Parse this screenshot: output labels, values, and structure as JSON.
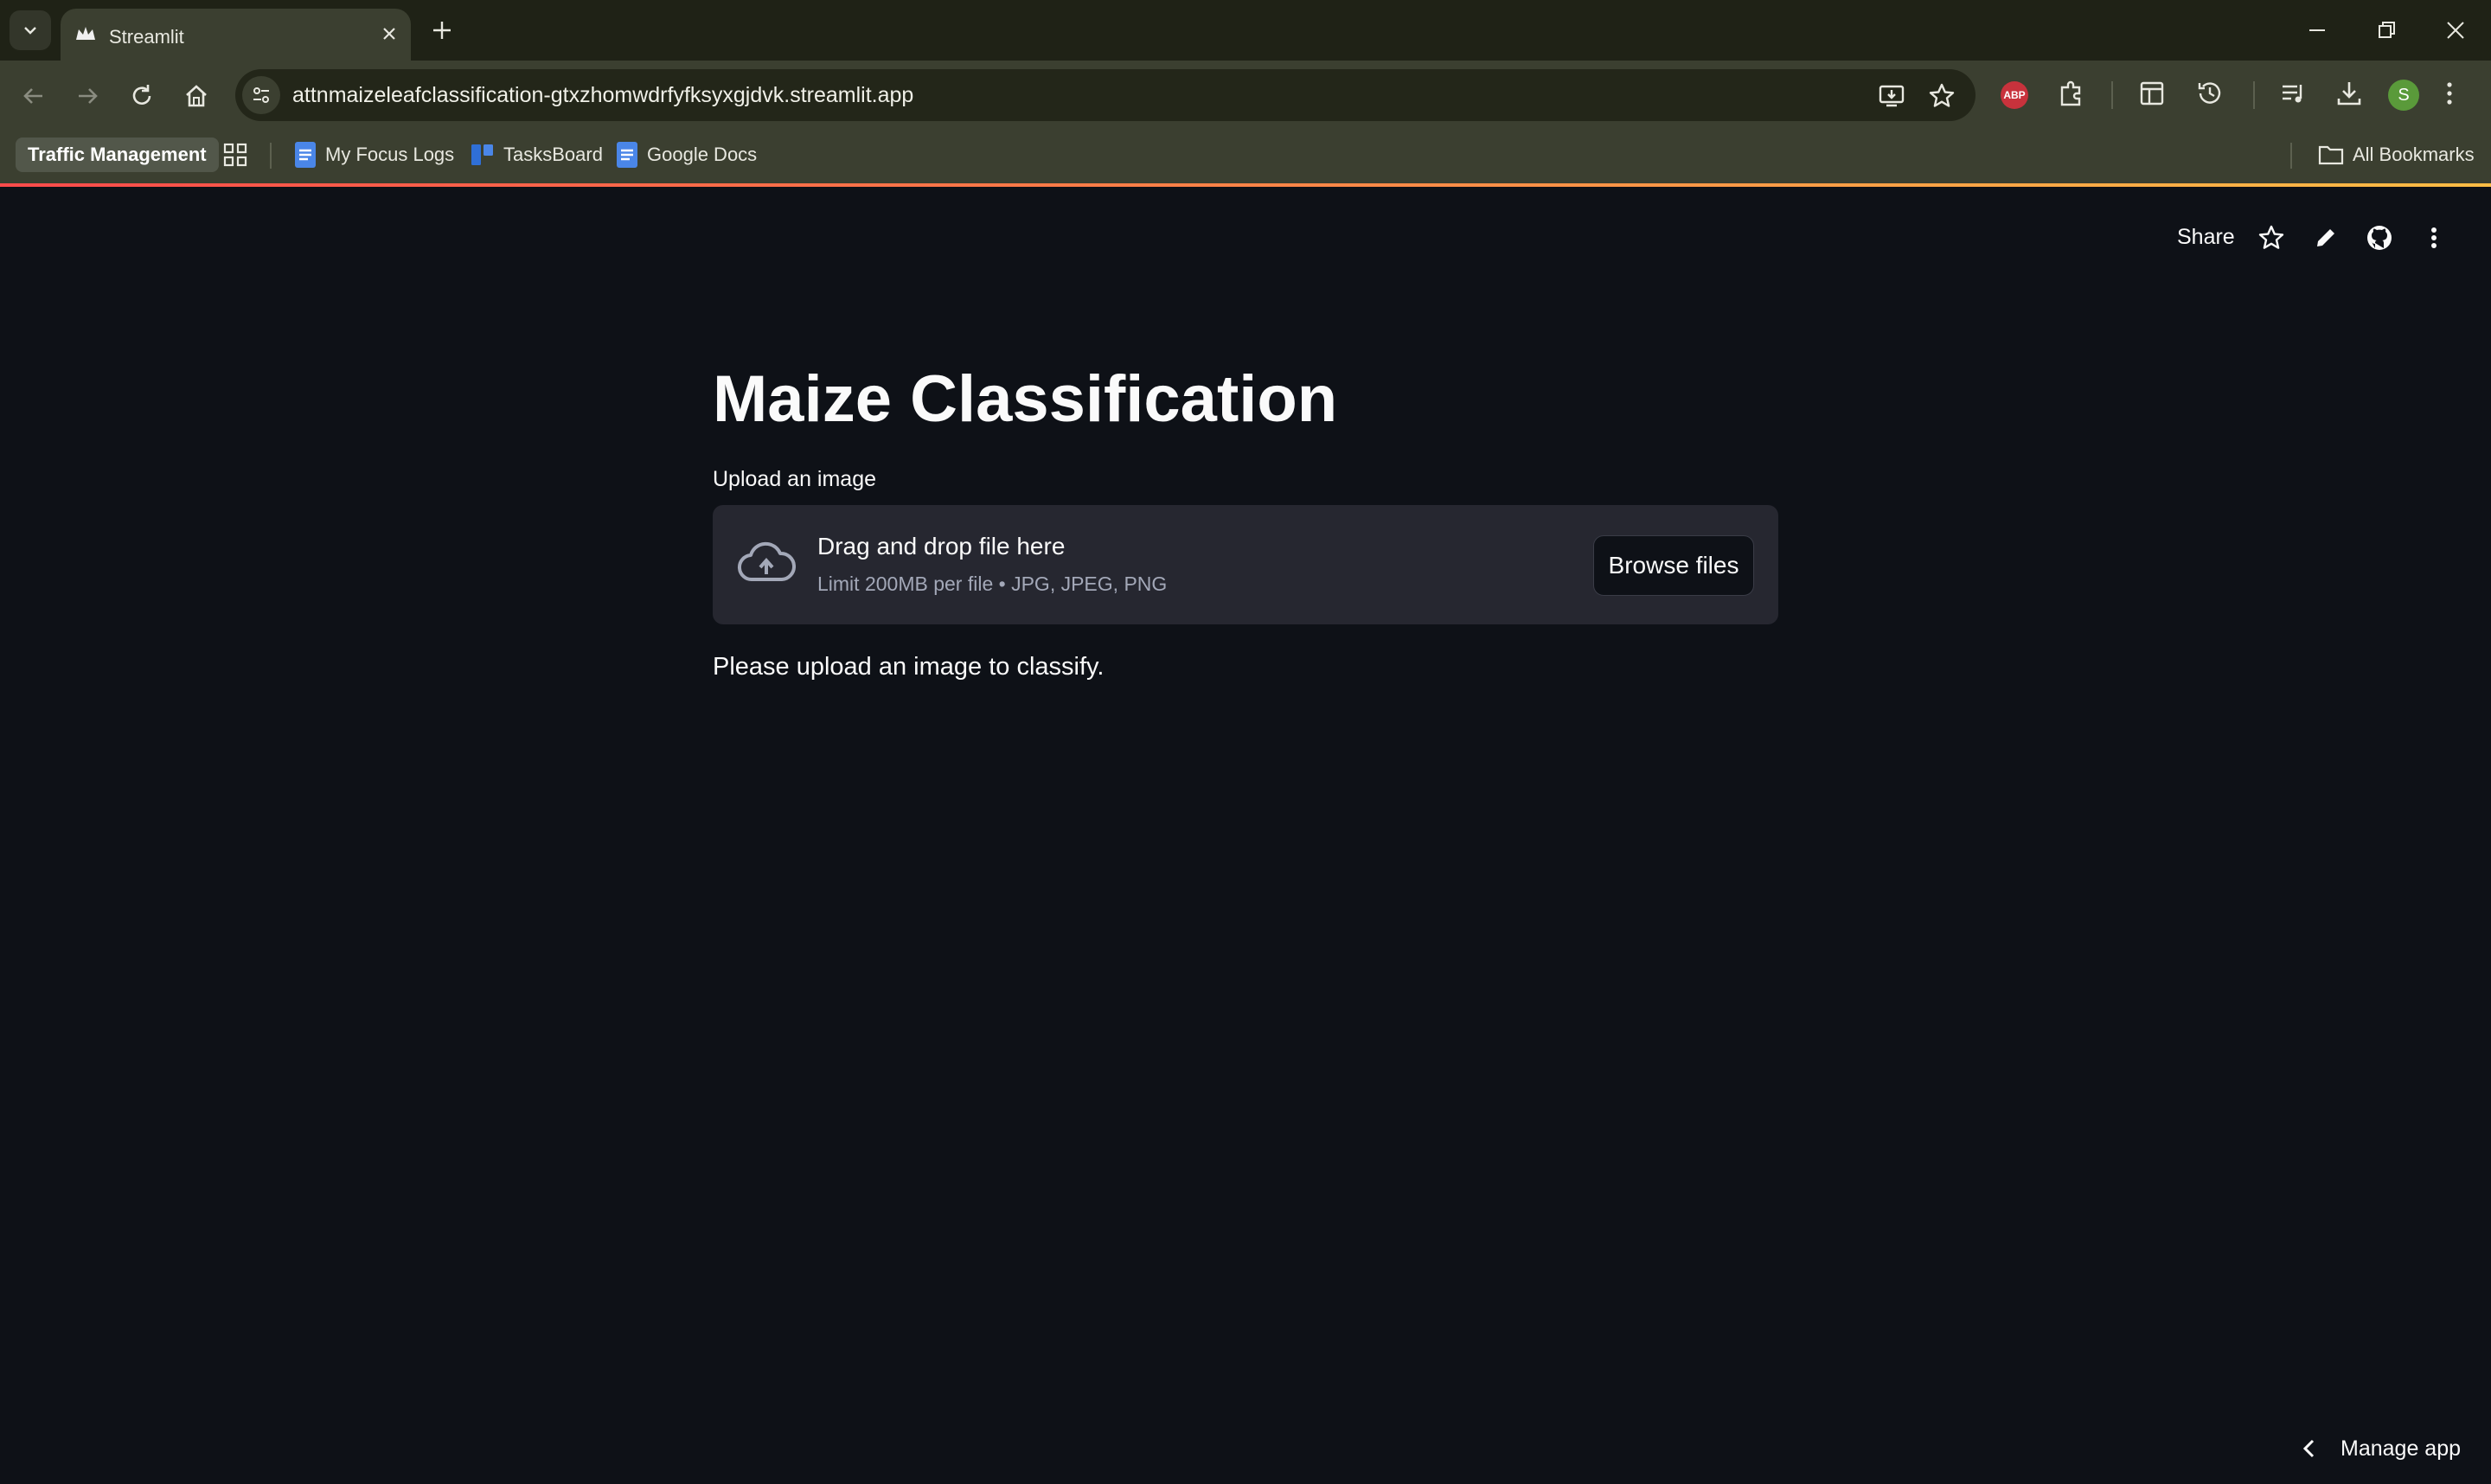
{
  "browser": {
    "tab": {
      "title": "Streamlit"
    },
    "address_bar": {
      "url": "attnmaizeleafclassification-gtxzhomwdrfyfksyxgjdvk.streamlit.app"
    },
    "profile_initial": "S",
    "adblock_label": "ABP",
    "bookmarks": {
      "group": "Traffic Management",
      "items": [
        {
          "label": "My Focus Logs",
          "icon": "google-docs-icon"
        },
        {
          "label": "TasksBoard",
          "icon": "tasksboard-icon"
        },
        {
          "label": "Google Docs",
          "icon": "google-docs-icon"
        }
      ],
      "all_bookmarks": "All Bookmarks"
    }
  },
  "app_header": {
    "share_label": "Share"
  },
  "main": {
    "title": "Maize Classification",
    "uploader": {
      "label": "Upload an image",
      "drop_text": "Drag and drop file here",
      "limit_text": "Limit 200MB per file • JPG, JPEG, PNG",
      "browse_label": "Browse files"
    },
    "status_message": "Please upload an image to classify."
  },
  "footer": {
    "manage_app_label": "Manage app"
  },
  "colors": {
    "background": "#0e1117",
    "dropzone": "#262730",
    "browser_chrome": "#3b3f30",
    "accent_start": "#ff4b4b",
    "accent_end": "#ffbd45"
  }
}
